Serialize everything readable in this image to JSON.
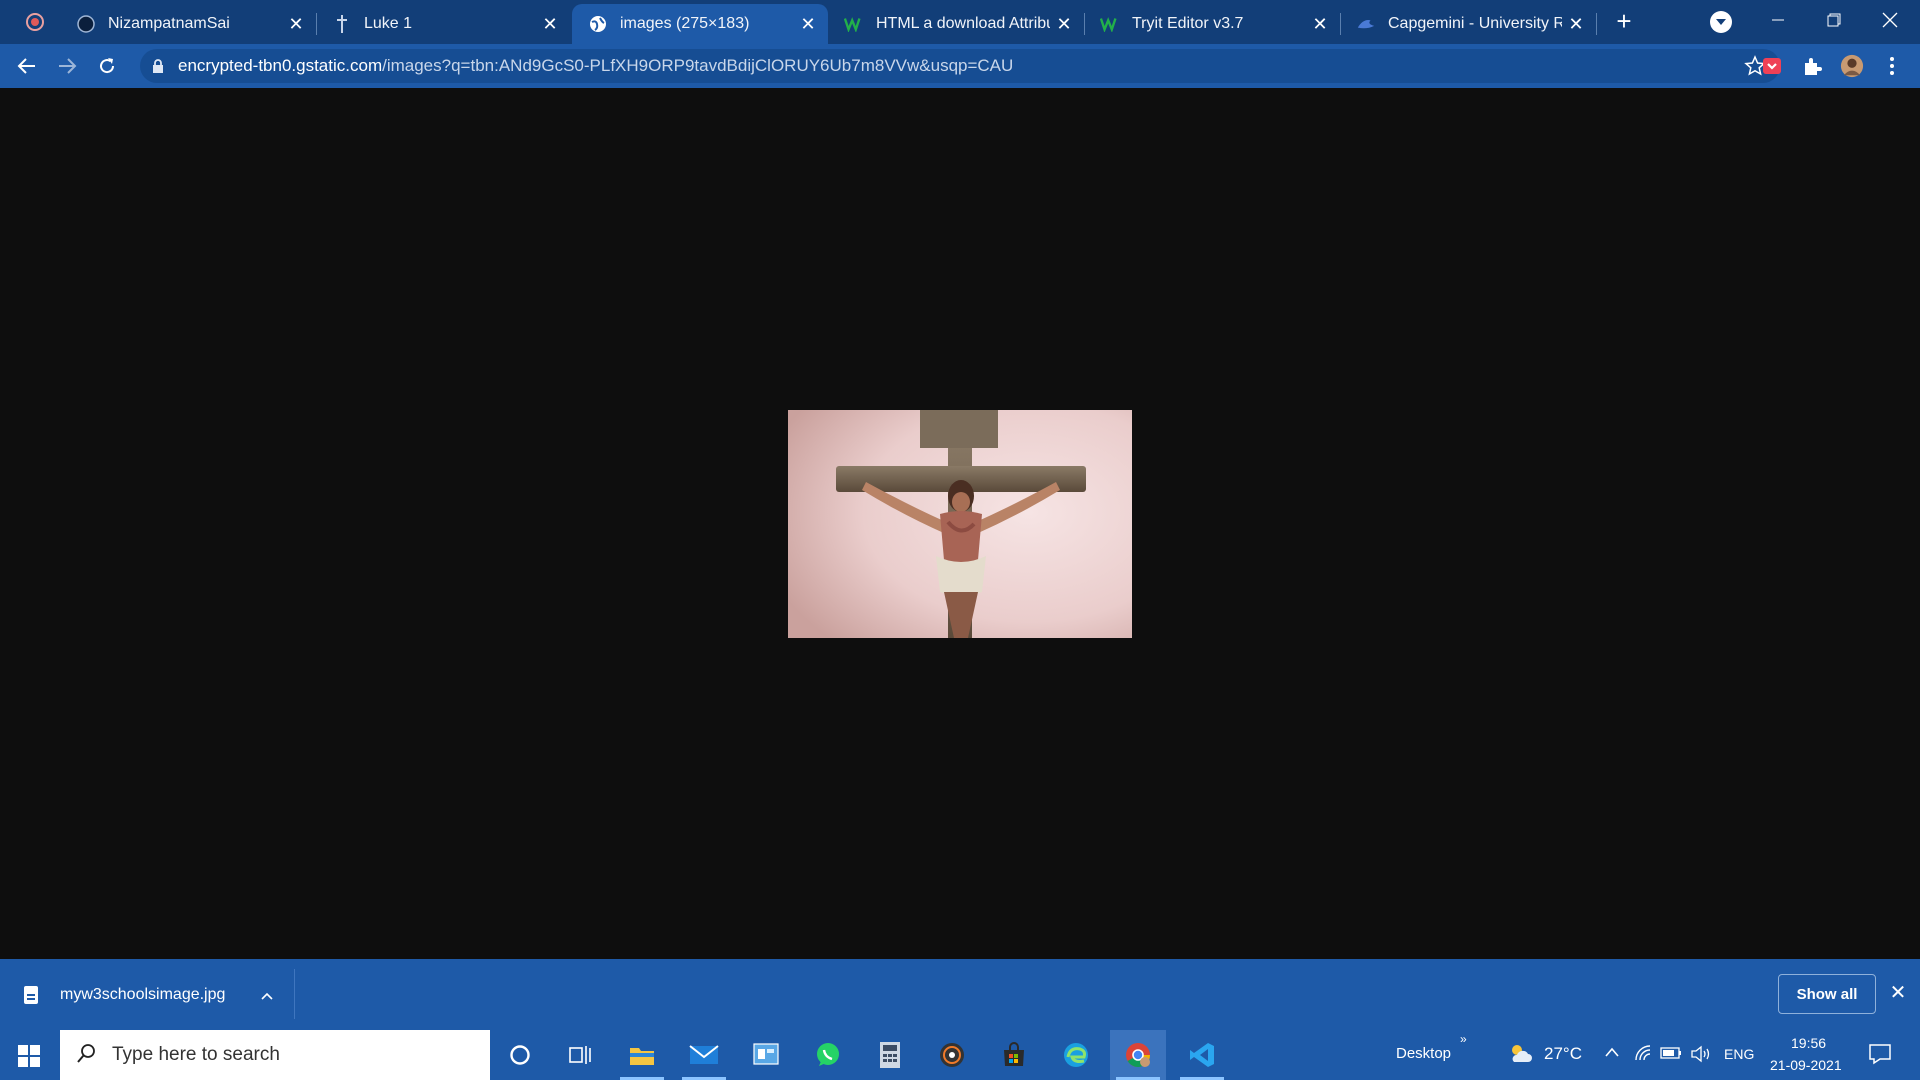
{
  "browser": {
    "tabs": [
      {
        "title": "NizampatnamSai",
        "icon": "github-icon",
        "active": false
      },
      {
        "title": "Luke 1",
        "icon": "bible-icon",
        "active": false
      },
      {
        "title": "images (275×183)",
        "icon": "globe-icon",
        "active": true
      },
      {
        "title": "HTML a download Attribute",
        "icon": "w3schools-icon",
        "active": false
      },
      {
        "title": "Tryit Editor v3.7",
        "icon": "w3schools-icon",
        "active": false
      },
      {
        "title": "Capgemini - University Re",
        "icon": "capgemini-icon",
        "active": false
      }
    ],
    "address": {
      "host": "encrypted-tbn0.gstatic.com",
      "path": "/images?q=tbn:ANd9GcS0-PLfXH9ORP9tavdBdijClORUY6Ub7m8VVw&usqp=CAU"
    }
  },
  "content": {
    "image_subject": "crucifixion-photo"
  },
  "downloads": {
    "filename": "myw3schoolsimage.jpg",
    "show_all_label": "Show all"
  },
  "taskbar": {
    "search_placeholder": "Type here to search",
    "desktop_label": "Desktop",
    "temperature": "27°C",
    "language": "ENG",
    "time": "19:56",
    "date": "21-09-2021"
  },
  "colors": {
    "frame": "#123e78",
    "toolbar": "#1e5aa8",
    "page_background": "#0e0e0e"
  }
}
